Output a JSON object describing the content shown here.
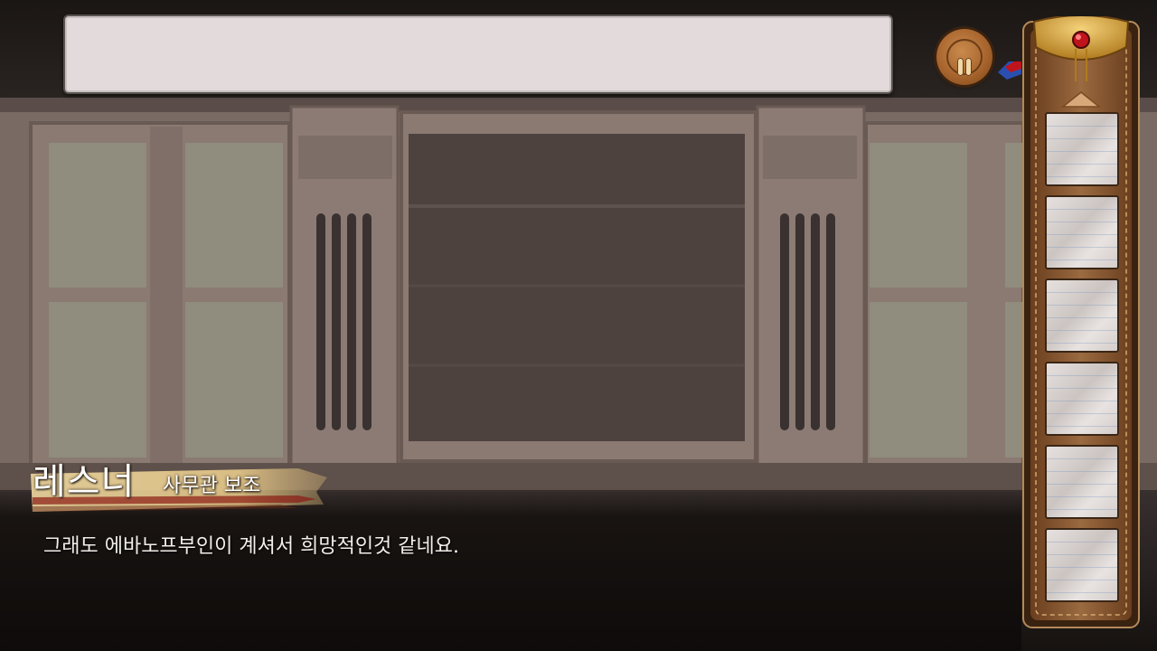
{
  "game": {
    "top_bar": {
      "value": ""
    },
    "pause_button": {
      "label": "pause"
    },
    "inventory": {
      "slots": [
        "",
        "",
        "",
        "",
        "",
        ""
      ],
      "scroll_up_icon": "triangle-up-icon"
    },
    "dialogue": {
      "speaker_name": "레스너",
      "speaker_role": "사무관 보조",
      "text": "그래도 에바노프부인이 계셔서 희망적인것 같네요."
    },
    "colors": {
      "top_bar_bg": "#e2dadb",
      "button_brown": "#a8652e",
      "panel_leather": "#8a5a34",
      "panel_gold": "#d6a53a",
      "gem_red": "#c0141c",
      "name_plate_gold": "#e6c98a"
    }
  }
}
